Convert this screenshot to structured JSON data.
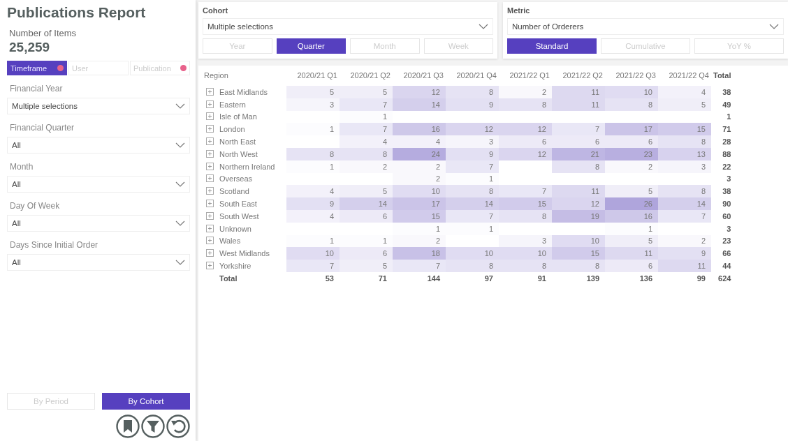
{
  "sidebar": {
    "title": "Publications Report",
    "kpi": {
      "label": "Number of Items",
      "value": "25,259"
    },
    "tabs": [
      {
        "label": "Timeframe",
        "selected": true,
        "filtered": true
      },
      {
        "label": "User",
        "selected": false,
        "filtered": false
      },
      {
        "label": "Publication",
        "selected": false,
        "filtered": true
      }
    ],
    "filters": [
      {
        "label": "Financial Year",
        "value": "Multiple selections"
      },
      {
        "label": "Financial Quarter",
        "value": "All"
      },
      {
        "label": "Month",
        "value": "All"
      },
      {
        "label": "Day Of Week",
        "value": "All"
      },
      {
        "label": "Days Since Initial Order",
        "value": "All"
      }
    ],
    "view_buttons": [
      {
        "label": "By Period",
        "selected": false
      },
      {
        "label": "By Cohort",
        "selected": true
      }
    ]
  },
  "cohort": {
    "title": "Cohort",
    "value": "Multiple selections",
    "options": [
      {
        "label": "Year",
        "selected": false
      },
      {
        "label": "Quarter",
        "selected": true
      },
      {
        "label": "Month",
        "selected": false
      },
      {
        "label": "Week",
        "selected": false
      }
    ]
  },
  "metric": {
    "title": "Metric",
    "value": "Number of Orderers",
    "options": [
      {
        "label": "Standard",
        "selected": true
      },
      {
        "label": "Cumulative",
        "selected": false
      },
      {
        "label": "YoY %",
        "selected": false
      }
    ]
  },
  "table": {
    "columns": [
      "Region",
      "2020/21 Q1",
      "2020/21 Q2",
      "2020/21 Q3",
      "2020/21 Q4",
      "2021/22 Q1",
      "2021/22 Q2",
      "2021/22 Q3",
      "2021/22 Q4",
      "Total"
    ],
    "rows": [
      {
        "kind": "region",
        "cells": [
          "East Midlands",
          "5",
          "5",
          "12",
          "8",
          "2",
          "11",
          "10",
          "4",
          "38"
        ]
      },
      {
        "kind": "region",
        "cells": [
          "Eastern",
          "3",
          "7",
          "14",
          "9",
          "8",
          "11",
          "8",
          "5",
          "49"
        ]
      },
      {
        "kind": "region",
        "cells": [
          "Isle of Man",
          "",
          "1",
          "",
          "",
          "",
          "",
          "",
          "",
          "1"
        ]
      },
      {
        "kind": "region",
        "cells": [
          "London",
          "1",
          "7",
          "16",
          "12",
          "12",
          "7",
          "17",
          "15",
          "71"
        ]
      },
      {
        "kind": "region",
        "cells": [
          "North East",
          "",
          "4",
          "4",
          "3",
          "6",
          "6",
          "6",
          "8",
          "28"
        ]
      },
      {
        "kind": "region",
        "cells": [
          "North West",
          "8",
          "8",
          "24",
          "9",
          "12",
          "21",
          "23",
          "13",
          "88"
        ]
      },
      {
        "kind": "region",
        "cells": [
          "Northern Ireland",
          "1",
          "2",
          "2",
          "7",
          "",
          "8",
          "2",
          "3",
          "22"
        ]
      },
      {
        "kind": "region",
        "cells": [
          "Overseas",
          "",
          "",
          "2",
          "1",
          "",
          "",
          "",
          "",
          "3"
        ]
      },
      {
        "kind": "region",
        "cells": [
          "Scotland",
          "4",
          "5",
          "10",
          "8",
          "7",
          "11",
          "5",
          "8",
          "38"
        ]
      },
      {
        "kind": "region",
        "cells": [
          "South East",
          "9",
          "14",
          "17",
          "14",
          "15",
          "12",
          "26",
          "14",
          "90"
        ]
      },
      {
        "kind": "region",
        "cells": [
          "South West",
          "4",
          "6",
          "15",
          "7",
          "8",
          "19",
          "16",
          "7",
          "60"
        ]
      },
      {
        "kind": "region",
        "cells": [
          "Unknown",
          "",
          "",
          "1",
          "1",
          "",
          "",
          "1",
          "",
          "3"
        ]
      },
      {
        "kind": "region",
        "cells": [
          "Wales",
          "1",
          "1",
          "2",
          "",
          "3",
          "10",
          "5",
          "2",
          "23"
        ]
      },
      {
        "kind": "region",
        "cells": [
          "West Midlands",
          "10",
          "6",
          "18",
          "10",
          "10",
          "15",
          "11",
          "9",
          "66"
        ]
      },
      {
        "kind": "region",
        "cells": [
          "Yorkshire",
          "7",
          "5",
          "7",
          "8",
          "8",
          "8",
          "6",
          "11",
          "44"
        ]
      },
      {
        "kind": "total",
        "cells": [
          "Total",
          "53",
          "71",
          "144",
          "97",
          "91",
          "139",
          "136",
          "99",
          "624"
        ]
      }
    ]
  }
}
